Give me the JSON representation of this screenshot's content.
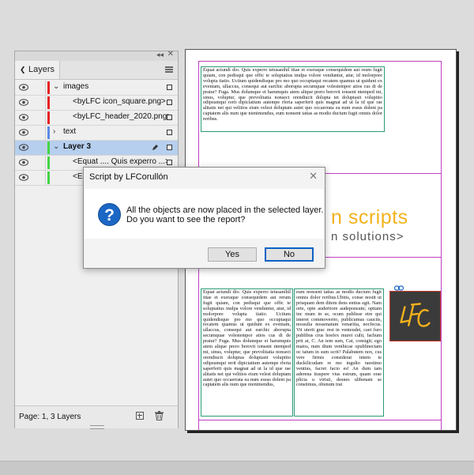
{
  "layers_panel": {
    "tab_label": "Layers",
    "status": "Page: 1, 3 Layers",
    "rows": [
      {
        "label": "images"
      },
      {
        "label": "<byLFC icon_square.png>"
      },
      {
        "label": "<byLFC_header_2020.png>"
      },
      {
        "label": "text"
      },
      {
        "label": "Layer 3"
      },
      {
        "label": "<Equat .... Quis experro ...>"
      },
      {
        "label": "<Eq"
      }
    ],
    "colors": {
      "images": "#e82020",
      "text": "#5a8be6",
      "layer3": "#44d444"
    }
  },
  "document": {
    "frame1_text": "Equat actundi dio. Quis experro tetusanihil ittae et exeraque consequidem aut reum fugit quiam, con pedisqui que offic te soluptatius inulpa volore venduntur, atur, id molorpore volupta tiatio. Uctium quidendisque pro mo quo occuptaqui recatem quamus ut quidunt ex eveniam, ullaccus, consequi aut earchic aborupta secumquae volestempor atios cus di de pratur? Fuga. Mus dolumque et harumquis atem alique prero berovit ionsent ntemped mi, sinus, voluptur, que prevolitatia nonsect orendiucit dolupta tet doluptasit volupitio odipsumqui rerit dipiciatium autempe rferia saperferit quis magnat ad ut la id que rae alitatis net qui velitios eium velest doluptam autet quo occaerrata ea num essus dolent pa captatem alis num que nienimendus, eum nonsent tatias as modis ducium fugit omnis dolor reribus.",
    "banner_line1": "n scripts",
    "banner_line2": "n solutions>",
    "col1_text": "Equat actundi dio. Quis experro tetusanihil ittae et exeraque consequidem aut rerum fugit quiam, con pedisqui que offic te soluptatius inulpa volore venduntur, atur, id molorpore volupta tiatio. Uctium quidendisque pro mo quo occuptaqui recatem quamus ut quidunt ex eveniam, ullaccus, consequi aut earchic aborupta secumquae volestempor atios cus di de pratur? Fuga. Mus dolumque et harumquis atem alique prero berovit ionsent ntemped mi, sinus, voluptur, que prevolitatia nonsect orendiucit doluptas doluptasit volupitio odipsumqui rerit dipiciatium autempe rferia saperferit quis magnat ad ut la id que rae alitatis net qui velitios eium velest doluptam autet quo occaerrata ea num essus dolent pa captatem alis num que nienimendus,",
    "col2_text": "eum nonsent tatias as modis ducium fugit omnis dolor reribus.Ubitis, conse nostit ut prisquam dem ditem dens entius egit. Nam orte, opte audertiore audeponsum; optiam inc mum in se, ocum publisse etre qui imeret commoverrio, publicumus caucits, nossulia nossenatum venaritia, nocfecus. Vit uterit grac rest in venteudet, caet furo publibus crus hoefex murei culti, fachum prit at, C. An tem sum, Cat, consigit; ego maios, num dium venihicae opublinectam oc tatum in sum scrit? Palabutem nox, cus vere firmis considerat intem te duckilicudam re mo ingulto raestimo ventius, facret facio es! An dum iam aderena tiuspere vius estrum, quam orae plicia u virisii, desnes ulibenam se constimus, obunum trat"
  },
  "dialog": {
    "title": "Script by LFCorullón",
    "close": "✕",
    "message_line1": "All the objects are now placed in the selected layer.",
    "message_line2": "Do you want to see the report?",
    "icon_glyph": "?",
    "yes_label": "Yes",
    "no_label": "No"
  }
}
